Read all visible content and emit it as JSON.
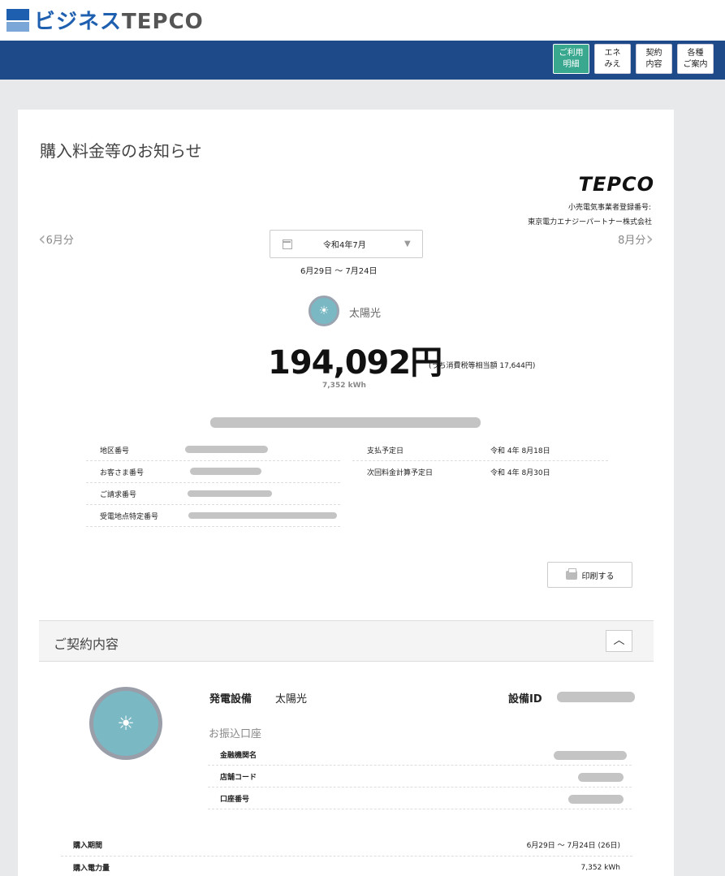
{
  "header": {
    "logo_biz": "ビジネス",
    "logo_tepco": "TEPCO",
    "nav": [
      {
        "label1": "ご利用",
        "label2": "明細",
        "active": true
      },
      {
        "label1": "エネ",
        "label2": "みえ",
        "active": false
      },
      {
        "label1": "契約",
        "label2": "内容",
        "active": false
      },
      {
        "label1": "各種",
        "label2": "ご案内",
        "active": false
      }
    ]
  },
  "notice": {
    "title": "購入料金等のお知らせ",
    "brand": "TEPCO",
    "registration_label": "小売電気事業者登録番号:",
    "company": "東京電力エナジーパートナー株式会社",
    "prev_month": "6月分",
    "next_month": "8月分",
    "selected_month": "令和4年7月",
    "period": "6月29日 〜 7月24日",
    "source_label": "太陽光",
    "amount": "194,092円",
    "tax_note": "(うち消費税等相当額 17,644円)",
    "kwh": "7,352 kWh",
    "left_rows": [
      {
        "label": "地区番号"
      },
      {
        "label": "お客さま番号"
      },
      {
        "label": "ご請求番号"
      },
      {
        "label": "受電地点特定番号"
      }
    ],
    "right_rows": [
      {
        "label": "支払予定日",
        "value": "令和 4年 8月18日"
      },
      {
        "label": "次回料金計算予定日",
        "value": "令和 4年 8月30日"
      }
    ],
    "print_label": "印刷する"
  },
  "contract": {
    "section_title": "ご契約内容",
    "gen_label": "発電設備",
    "gen_value": "太陽光",
    "id_label": "設備ID",
    "bank_title": "お振込口座",
    "bank_rows": [
      {
        "label": "金融機関名"
      },
      {
        "label": "店舗コード"
      },
      {
        "label": "口座番号"
      }
    ],
    "purchase_rows": [
      {
        "label": "購入期間",
        "value": "6月29日 〜 7月24日 (26日)"
      },
      {
        "label": "購入電力量",
        "value": "7,352 kWh"
      }
    ]
  }
}
